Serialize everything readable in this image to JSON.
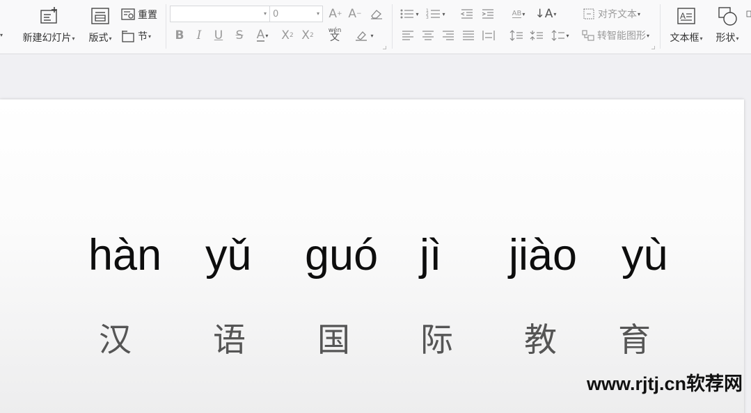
{
  "ribbon": {
    "new_slide": "新建幻灯片",
    "layout": "版式",
    "reset": "重置",
    "section": "节",
    "font_name_value": "",
    "font_size_value": "0",
    "align_text": "对齐文本",
    "smartart": "转智能图形",
    "textbox": "文本框",
    "shape": "形状",
    "ab_label": "AB",
    "pinyin_guide_label": "wén"
  },
  "slide": {
    "pinyin": [
      "hàn",
      "yǔ",
      "guó",
      "jì",
      "jiào",
      "yù"
    ],
    "hanzi": [
      "汉",
      "语",
      "国",
      "际",
      "教",
      "育"
    ]
  },
  "watermark": "www.rjtj.cn软荐网",
  "colors": {
    "ribbon_bg": "#f9f9fa",
    "workspace_bg": "#f0f0f3",
    "pinyin": "#0d0d0d",
    "hanzi": "#555555"
  }
}
